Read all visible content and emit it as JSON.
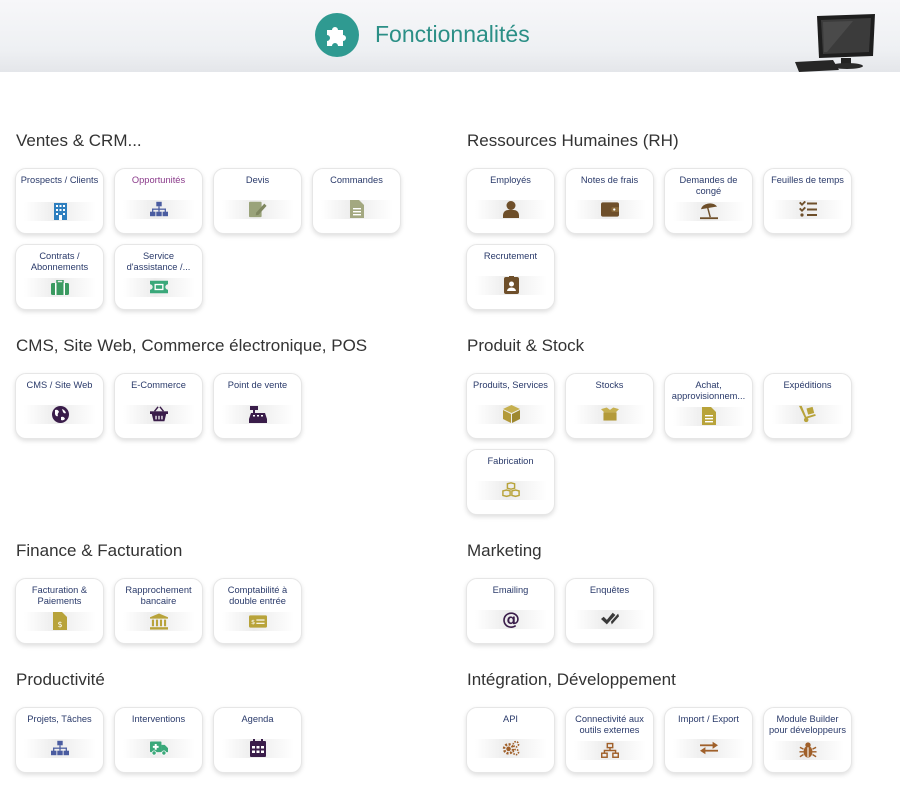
{
  "header": {
    "title": "Fonctionnalités"
  },
  "colors": {
    "teal": "#2f9a91",
    "crm": "#2e7fbf",
    "hr": "#6e4f2a",
    "cms": "#3a1d4a",
    "product": "#b39a3a",
    "finance": "#b8a33a",
    "marketing": "#3a1d4a",
    "productivity": "#4a3a8a",
    "integration": "#a0602a"
  },
  "sections": {
    "crm": {
      "title": "Ventes & CRM...",
      "items": [
        {
          "label": "Prospects / Clients",
          "icon": "building-icon"
        },
        {
          "label": "Opportunités",
          "icon": "hierarchy-icon"
        },
        {
          "label": "Devis",
          "icon": "edit-document-icon"
        },
        {
          "label": "Commandes",
          "icon": "document-icon"
        },
        {
          "label": "Contrats / Abonnements",
          "icon": "suitcase-icon"
        },
        {
          "label": "Service d'assistance /...",
          "icon": "ticket-icon"
        }
      ]
    },
    "hr": {
      "title": "Ressources Humaines (RH)",
      "items": [
        {
          "label": "Employés",
          "icon": "user-icon"
        },
        {
          "label": "Notes de frais",
          "icon": "wallet-icon"
        },
        {
          "label": "Demandes de congé",
          "icon": "umbrella-beach-icon"
        },
        {
          "label": "Feuilles de temps",
          "icon": "tasks-icon"
        },
        {
          "label": "Recrutement",
          "icon": "id-badge-icon"
        }
      ]
    },
    "cms": {
      "title": "CMS, Site Web, Commerce électronique, POS",
      "items": [
        {
          "label": "CMS / Site Web",
          "icon": "globe-icon"
        },
        {
          "label": "E-Commerce",
          "icon": "basket-icon"
        },
        {
          "label": "Point de vente",
          "icon": "cash-register-icon"
        }
      ]
    },
    "product": {
      "title": "Produit & Stock",
      "items": [
        {
          "label": "Produits, Services",
          "icon": "cube-icon"
        },
        {
          "label": "Stocks",
          "icon": "open-box-icon"
        },
        {
          "label": "Achat, approvisionnem...",
          "icon": "document-icon"
        },
        {
          "label": "Expéditions",
          "icon": "dolly-icon"
        },
        {
          "label": "Fabrication",
          "icon": "cubes-icon"
        }
      ]
    },
    "finance": {
      "title": "Finance & Facturation",
      "items": [
        {
          "label": "Facturation & Paiements",
          "icon": "invoice-dollar-icon"
        },
        {
          "label": "Rapprochement bancaire",
          "icon": "bank-icon"
        },
        {
          "label": "Comptabilité à double entrée",
          "icon": "money-check-icon"
        }
      ]
    },
    "marketing": {
      "title": "Marketing",
      "items": [
        {
          "label": "Emailing",
          "icon": "at-icon"
        },
        {
          "label": "Enquêtes",
          "icon": "double-check-icon"
        }
      ]
    },
    "productivity": {
      "title": "Productivité",
      "items": [
        {
          "label": "Projets, Tâches",
          "icon": "hierarchy-icon"
        },
        {
          "label": "Interventions",
          "icon": "ambulance-icon"
        },
        {
          "label": "Agenda",
          "icon": "calendar-icon"
        }
      ]
    },
    "integration": {
      "title": "Intégration, Développement",
      "items": [
        {
          "label": "API",
          "icon": "cogs-icon"
        },
        {
          "label": "Connectivité aux outils externes",
          "icon": "network-icon"
        },
        {
          "label": "Import / Export",
          "icon": "exchange-icon"
        },
        {
          "label": "Module Builder pour développeurs",
          "icon": "bug-icon"
        }
      ]
    }
  }
}
